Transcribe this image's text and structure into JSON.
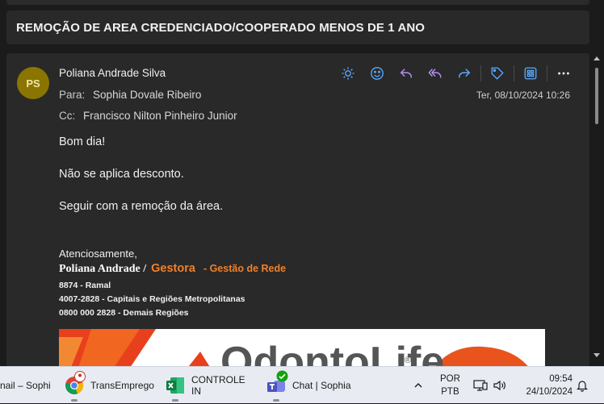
{
  "subject": "REMOÇÃO DE AREA CREDENCIADO/COOPERADO MENOS DE 1 ANO",
  "message": {
    "avatar_initials": "PS",
    "from": "Poliana Andrade Silva",
    "to_label": "Para:",
    "to": "Sophia Dovale Ribeiro",
    "cc_label": "Cc:",
    "cc": "Francisco Nilton Pinheiro Junior",
    "date": "Ter, 08/10/2024 10:26",
    "toolbar_icons": [
      "sun-icon",
      "smiley-icon",
      "reply-icon",
      "reply-all-icon",
      "forward-icon",
      "tag-icon",
      "apps-icon",
      "more-icon"
    ],
    "body": [
      "Bom dia!",
      "Não se aplica desconto.",
      "Seguir com a remoção da área."
    ],
    "signature": {
      "regards": "Atenciosamente,",
      "name": "Poliana Andrade /",
      "brand": "Gestora",
      "dept": "- Gestão de Rede",
      "lines": [
        "8874 - Ramal",
        "4007-2828 - Capitais e Regiões Metropolitanas",
        "0800 000 2828 - Demais Regiões"
      ]
    },
    "banner_text": "OdontoLife",
    "banner_reg": "®"
  },
  "taskbar": {
    "items": [
      {
        "label": "nail – Sophi"
      },
      {
        "label": "TransEmprego"
      },
      {
        "label": "CONTROLE IN"
      },
      {
        "label": "Chat | Sophia"
      }
    ],
    "language": "POR",
    "layout": "PTB",
    "time": "09:54",
    "date": "24/10/2024"
  },
  "colors": {
    "accent_blue": "#5aa9ff",
    "accent_purple": "#b48ef5",
    "brand_orange": "#f0802a",
    "avatar": "#8a7500"
  }
}
